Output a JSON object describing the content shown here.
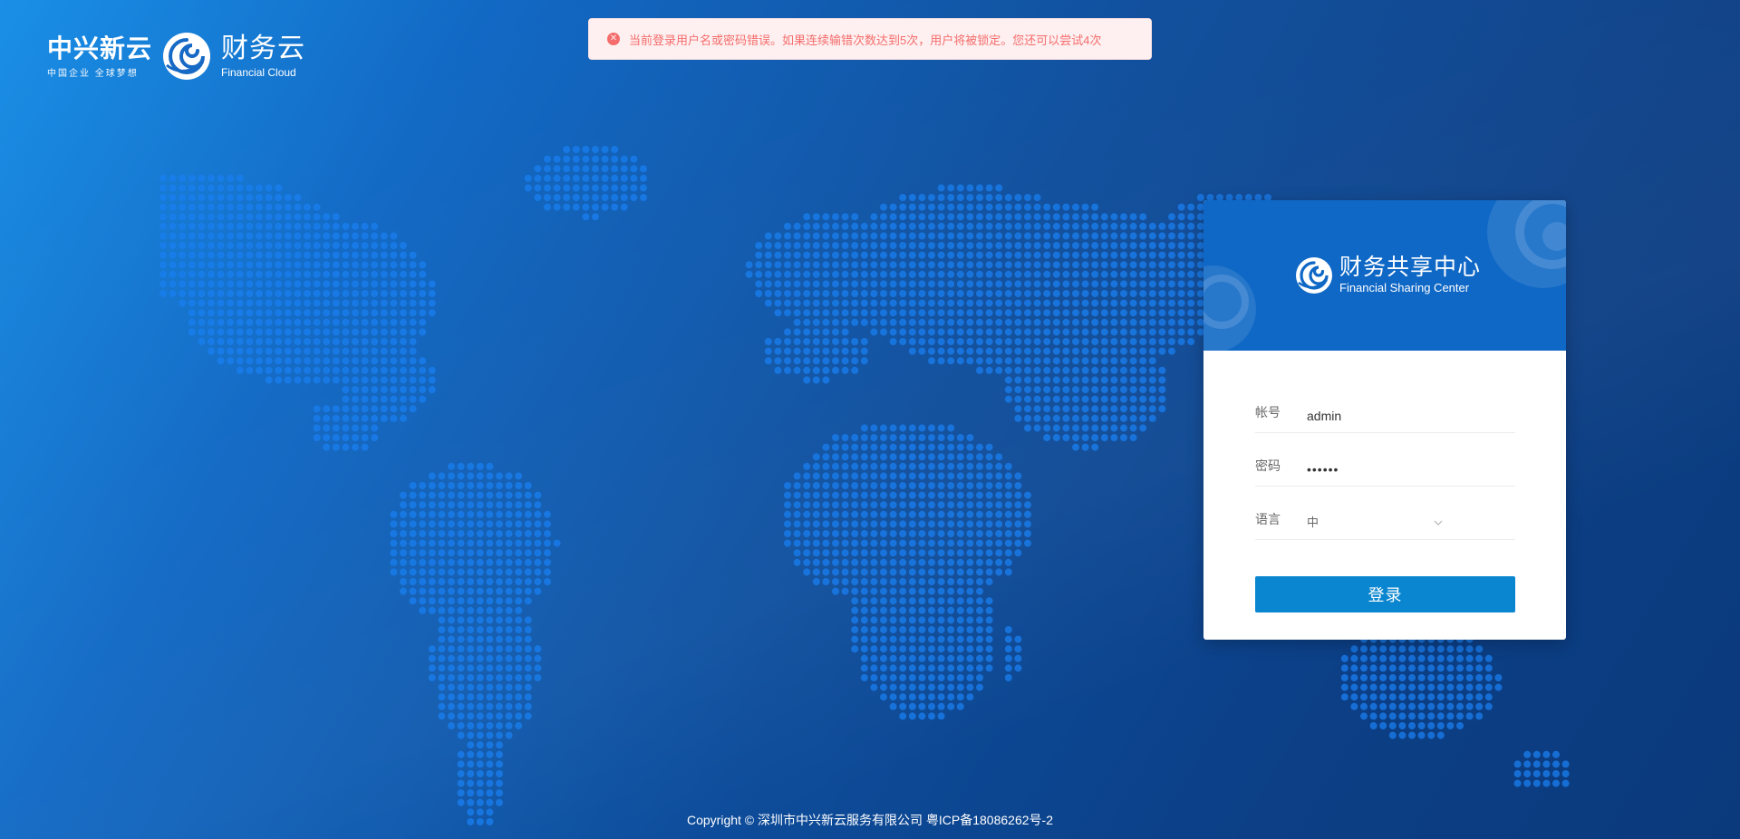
{
  "brand": {
    "company_name": "中兴新云",
    "slogan": "中国企业 全球梦想",
    "product_name": "财务云",
    "product_name_en": "Financial Cloud"
  },
  "toast": {
    "icon": "error-circle-icon",
    "message": "当前登录用户名或密码错误。如果连续输错次数达到5次，用户将被锁定。您还可以尝试4次",
    "color": "#f56c6c",
    "background": "#fef0f0"
  },
  "login_card": {
    "title_cn": "财务共享中心",
    "title_en": "Financial Sharing Center",
    "header_color": "#0f68c6",
    "fields": {
      "account": {
        "label": "帐号",
        "value": "admin"
      },
      "password": {
        "label": "密码",
        "value": "••••••"
      },
      "language": {
        "label": "语言",
        "value": "中"
      }
    },
    "submit_label": "登录",
    "button_color": "#0a86d0"
  },
  "footer": {
    "copyright": "Copyright © 深圳市中兴新云服务有限公司 粤ICP备18086262号-2"
  },
  "background": {
    "gradient_start": "#1a8fe6",
    "gradient_end": "#0b3a7c",
    "dot_color": "#1a7ff0"
  }
}
